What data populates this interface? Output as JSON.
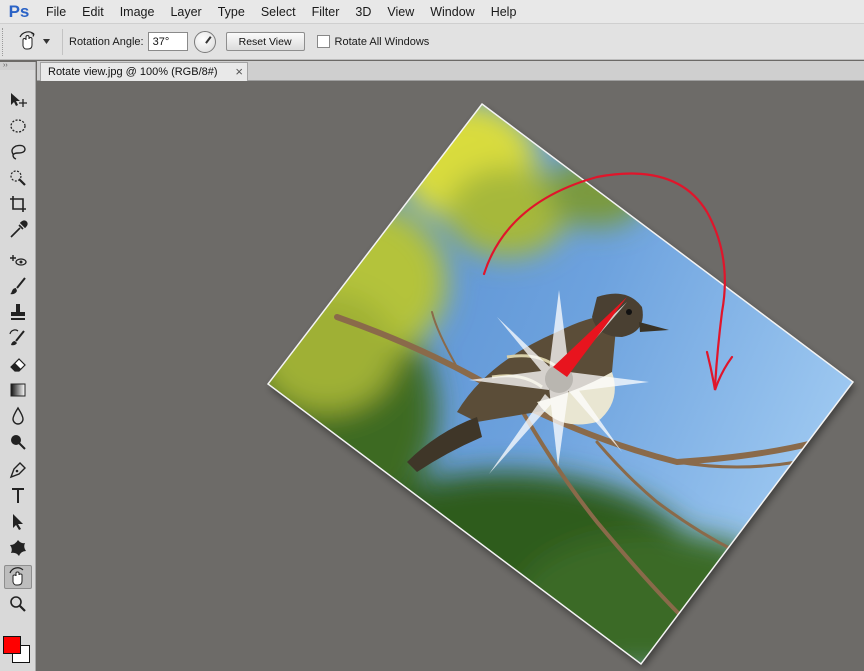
{
  "app": {
    "logo": "Ps"
  },
  "menu": [
    "File",
    "Edit",
    "Image",
    "Layer",
    "Type",
    "Select",
    "Filter",
    "3D",
    "View",
    "Window",
    "Help"
  ],
  "options": {
    "rotation_label": "Rotation Angle:",
    "rotation_value": "37°",
    "reset_label": "Reset View",
    "rotate_all_label": "Rotate All Windows",
    "rotate_all_checked": false
  },
  "document": {
    "tab_title": "Rotate view.jpg @ 100% (RGB/8#)",
    "close_glyph": "×",
    "rotation_deg": 37
  },
  "tools": [
    "move-icon",
    "marquee-icon",
    "lasso-icon",
    "quick-select-icon",
    "crop-icon",
    "eyedropper-icon",
    "healing-icon",
    "brush-icon",
    "stamp-icon",
    "history-brush-icon",
    "eraser-icon",
    "gradient-icon",
    "blur-icon",
    "dodge-icon",
    "pen-icon",
    "type-icon",
    "path-select-icon",
    "shape-icon",
    "rotate-view-icon",
    "zoom-icon"
  ],
  "colors": {
    "foreground": "#ff0000",
    "background": "#ffffff",
    "canvas": "#6d6b68",
    "annotation": "#e0152b"
  },
  "swap_glyph": "⇆"
}
